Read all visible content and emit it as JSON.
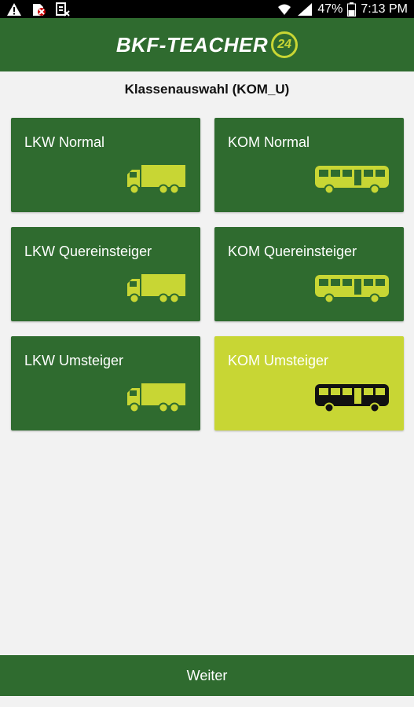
{
  "status_bar": {
    "battery": "47%",
    "time": "7:13 PM",
    "icons": [
      "warning-icon",
      "no-sim-icon",
      "document-x-icon",
      "wifi-icon",
      "signal-icon",
      "battery-icon"
    ]
  },
  "header": {
    "logo_text": "BKF-TEACHER",
    "logo_badge": "24"
  },
  "page": {
    "title": "Klassenauswahl (KOM_U)"
  },
  "tiles": [
    {
      "label": "LKW Normal",
      "icon": "truck-icon",
      "selected": false
    },
    {
      "label": "KOM Normal",
      "icon": "bus-icon",
      "selected": false
    },
    {
      "label": "LKW Quereinsteiger",
      "icon": "truck-icon",
      "selected": false
    },
    {
      "label": "KOM Quereinsteiger",
      "icon": "bus-icon",
      "selected": false
    },
    {
      "label": "LKW Umsteiger",
      "icon": "truck-icon",
      "selected": false
    },
    {
      "label": "KOM Umsteiger",
      "icon": "bus-icon",
      "selected": true
    }
  ],
  "footer": {
    "next_label": "Weiter"
  },
  "colors": {
    "primary_green": "#2f6b2f",
    "accent_lime": "#c8d634",
    "background": "#f2f2f2"
  }
}
